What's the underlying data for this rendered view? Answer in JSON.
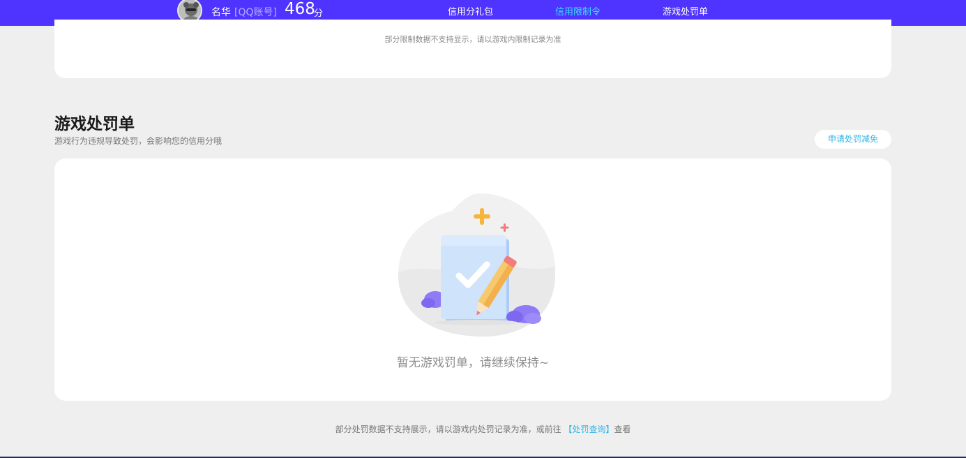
{
  "header": {
    "user_name": "名华",
    "account_type": "[QQ账号]",
    "score": "468",
    "score_unit": "分",
    "tabs": [
      {
        "label": "信用分礼包",
        "active": false
      },
      {
        "label": "信用限制令",
        "active": true
      },
      {
        "label": "游戏处罚单",
        "active": false
      }
    ],
    "bg_color": "#4f33ff",
    "active_color": "#3be0ff"
  },
  "restriction_card": {
    "note": "部分限制数据不支持显示，请以游戏内限制记录为准"
  },
  "penalty_section": {
    "title": "游戏处罚单",
    "subtitle": "游戏行为违规导致处罚，会影响您的信用分哦",
    "appeal_button": "申请处罚减免",
    "empty_icon": "document-check-pencil-illustration",
    "empty_text": "暂无游戏罚单，请继续保持~"
  },
  "footer": {
    "note_prefix": "部分处罚数据不支持展示，请以游戏内处罚记录为准，或前往 ",
    "link_text": "【处罚查询】",
    "note_suffix": "查看",
    "link_color": "#2fb6e8"
  }
}
